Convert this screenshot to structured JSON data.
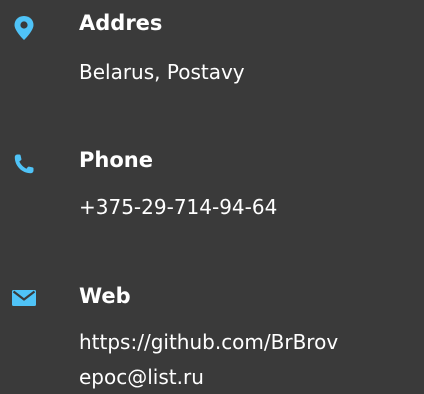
{
  "accent_color": "#4fc3f7",
  "contact": {
    "address": {
      "icon": "map-pin-icon",
      "title": "Addres",
      "value": "Belarus, Postavy"
    },
    "phone": {
      "icon": "phone-icon",
      "title": "Phone",
      "value": "+375-29-714-94-64"
    },
    "web": {
      "icon": "envelope-icon",
      "title": "Web",
      "values": [
        "https://github.com/BrBrov",
        "epoc@list.ru"
      ]
    }
  }
}
